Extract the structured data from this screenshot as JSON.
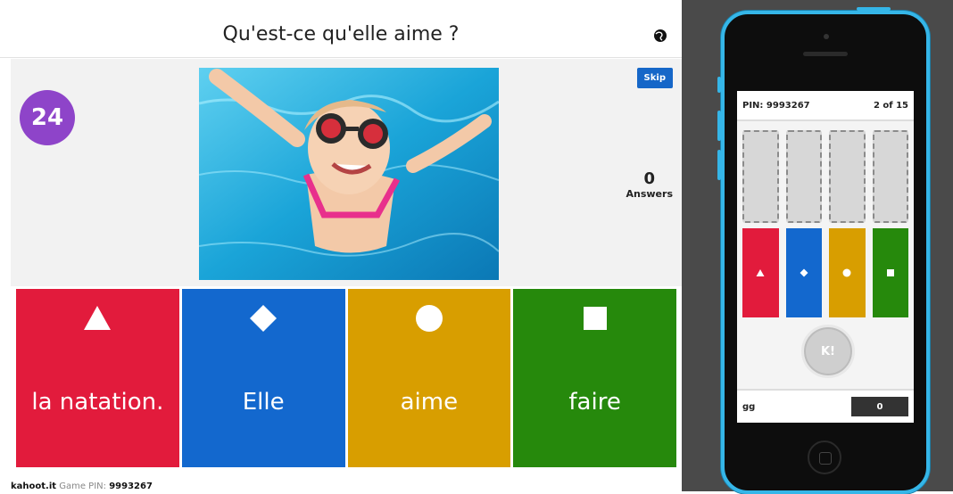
{
  "question": {
    "title": "Qu'est-ce qu'elle aime ?",
    "timer": "24",
    "skip_label": "Skip",
    "answers_count": "0",
    "answers_label": "Answers"
  },
  "answers": [
    {
      "label": "la natation.",
      "color": "#e21b3c",
      "shape": "triangle-icon"
    },
    {
      "label": "Elle",
      "color": "#1368ce",
      "shape": "diamond-icon"
    },
    {
      "label": "aime",
      "color": "#d89e00",
      "shape": "circle-icon"
    },
    {
      "label": "faire",
      "color": "#26890c",
      "shape": "square-icon"
    }
  ],
  "footer": {
    "brand": "kahoot.it",
    "pin_label": "Game PIN:",
    "pin_value": "9993267"
  },
  "phone": {
    "pin": "PIN: 9993267",
    "progress": "2 of 15",
    "submit_label": "K!",
    "nickname": "gg",
    "score": "0"
  },
  "colors": {
    "timer": "#8e44c9",
    "skip": "#1667c8",
    "phone_frame": "#35b6e8"
  }
}
